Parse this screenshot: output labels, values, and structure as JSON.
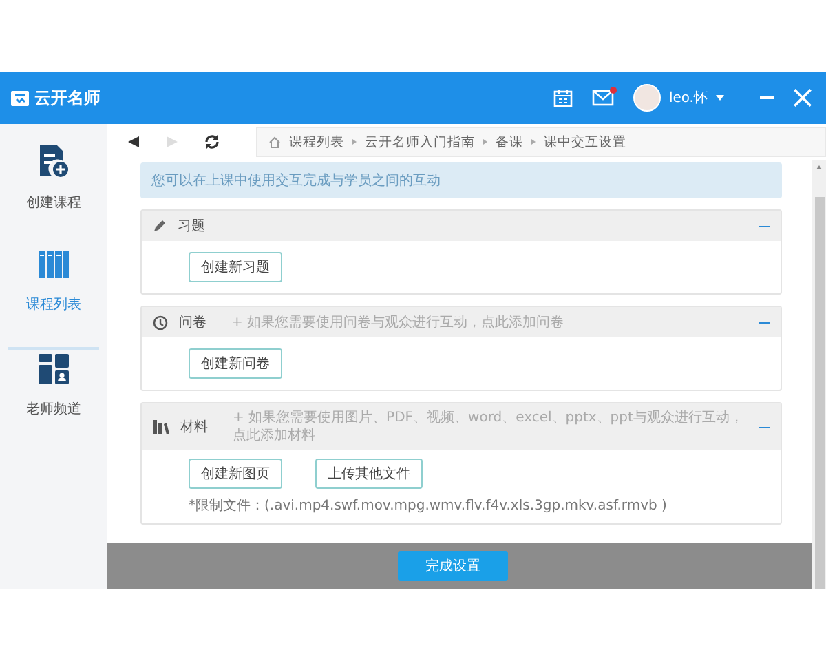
{
  "window": {
    "title": "云开名师",
    "user": "leo.怀",
    "mail_unread": true
  },
  "sidebar": {
    "items": [
      {
        "kind": "create",
        "label": "创建课程",
        "selected": false
      },
      {
        "kind": "list",
        "label": "课程列表",
        "selected": true
      },
      {
        "kind": "teacher",
        "label": "老师频道",
        "selected": false
      }
    ]
  },
  "nav": [
    {
      "kind": "back",
      "disabled": false
    },
    {
      "kind": "forward",
      "disabled": true
    },
    {
      "kind": "refresh",
      "disabled": false
    }
  ],
  "breadcrumb": [
    "课程列表",
    "云开名师入门指南",
    "备课",
    "课中交互设置"
  ],
  "info": "您可以在上课中使用交互完成与学员之间的互动",
  "sections": [
    {
      "kind": "exercise",
      "title": "习题",
      "expanded": true,
      "buttons": [
        "创建新习题"
      ]
    },
    {
      "kind": "survey",
      "title": "问卷",
      "hint": "+ 如果您需要使用问卷与观众进行互动，点此添加问卷",
      "expanded": true,
      "buttons": [
        "创建新问卷"
      ]
    },
    {
      "kind": "material",
      "title": "材料",
      "hint": "+ 如果您需要使用图片、PDF、视频、word、excel、pptx、ppt与观众进行互动，点此添加材料",
      "expanded": true,
      "buttons": [
        "创建新图页",
        "上传其他文件"
      ],
      "note": "*限制文件：(.avi.mp4.swf.mov.mpg.wmv.flv.f4v.xls.3gp.mkv.asf.rmvb )"
    }
  ],
  "footer": {
    "button": "完成设置"
  }
}
